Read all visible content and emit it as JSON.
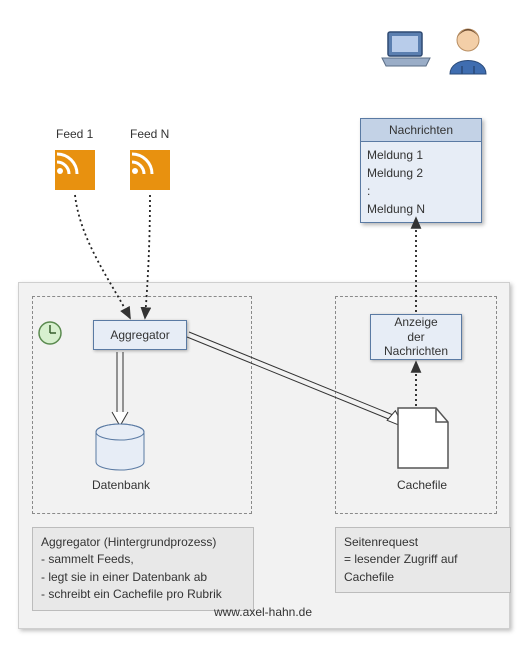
{
  "feeds": {
    "feed1_label": "Feed 1",
    "feedn_label": "Feed N"
  },
  "nachrichten": {
    "title": "Nachrichten",
    "line1": "Meldung 1",
    "line2": "Meldung 2",
    "line3": ":",
    "line4": "Meldung N"
  },
  "aggregator": {
    "label": "Aggregator"
  },
  "anzeige": {
    "line1": "Anzeige",
    "line2": "der",
    "line3": "Nachrichten"
  },
  "datenbank": {
    "label": "Datenbank"
  },
  "cachefile": {
    "label": "Cachefile"
  },
  "note_left": {
    "title": "Aggregator (Hintergrundprozess)",
    "b1": "- sammelt Feeds,",
    "b2": "- legt sie in einer Datenbank ab",
    "b3": "- schreibt ein Cachefile pro Rubrik"
  },
  "note_right": {
    "l1": "Seitenrequest",
    "l2": "= lesender Zugriff auf Cachefile"
  },
  "footer": {
    "url": "www.axel-hahn.de"
  },
  "icons": {
    "rss": "rss-icon",
    "clock": "clock-icon",
    "database": "database-icon",
    "file": "file-icon",
    "laptop": "laptop-icon",
    "user": "user-icon"
  }
}
